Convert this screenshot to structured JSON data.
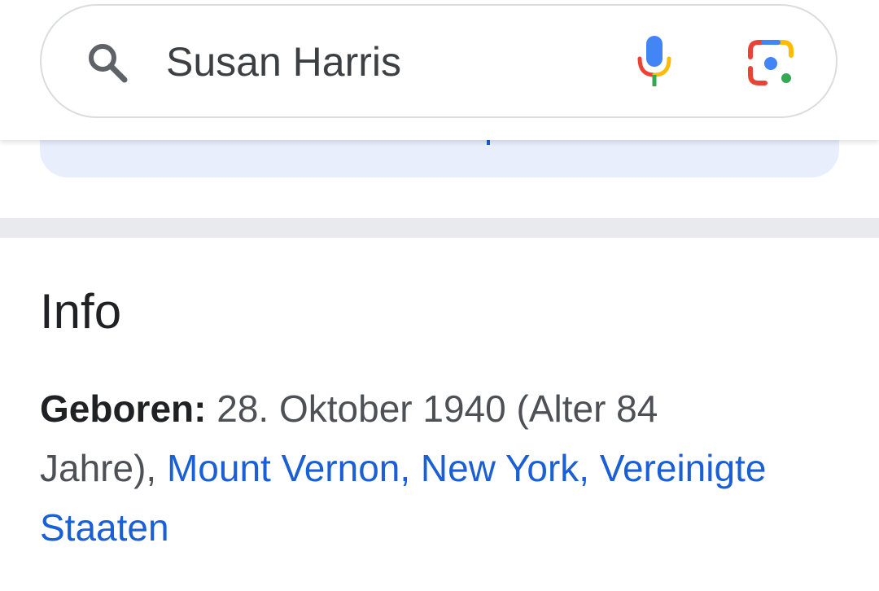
{
  "search": {
    "query": "Susan Harris",
    "icons": {
      "search": "search-icon",
      "voice": "mic-icon",
      "lens": "google-lens-icon"
    }
  },
  "info": {
    "title": "Info",
    "born": {
      "label": "Geboren:",
      "date_text": "28. Oktober 1940 (Alter 84 Jahre),",
      "place_link": "Mount Vernon, New York, Vereinigte Staaten"
    }
  },
  "colors": {
    "link": "#1a5fd6",
    "text": "#202124",
    "secondary_text": "#4d5156",
    "divider": "#e8eaed",
    "card_bg": "#e8eefc",
    "google_blue": "#4285f4",
    "google_red": "#ea4335",
    "google_yellow": "#fbbc04",
    "google_green": "#34a853"
  }
}
